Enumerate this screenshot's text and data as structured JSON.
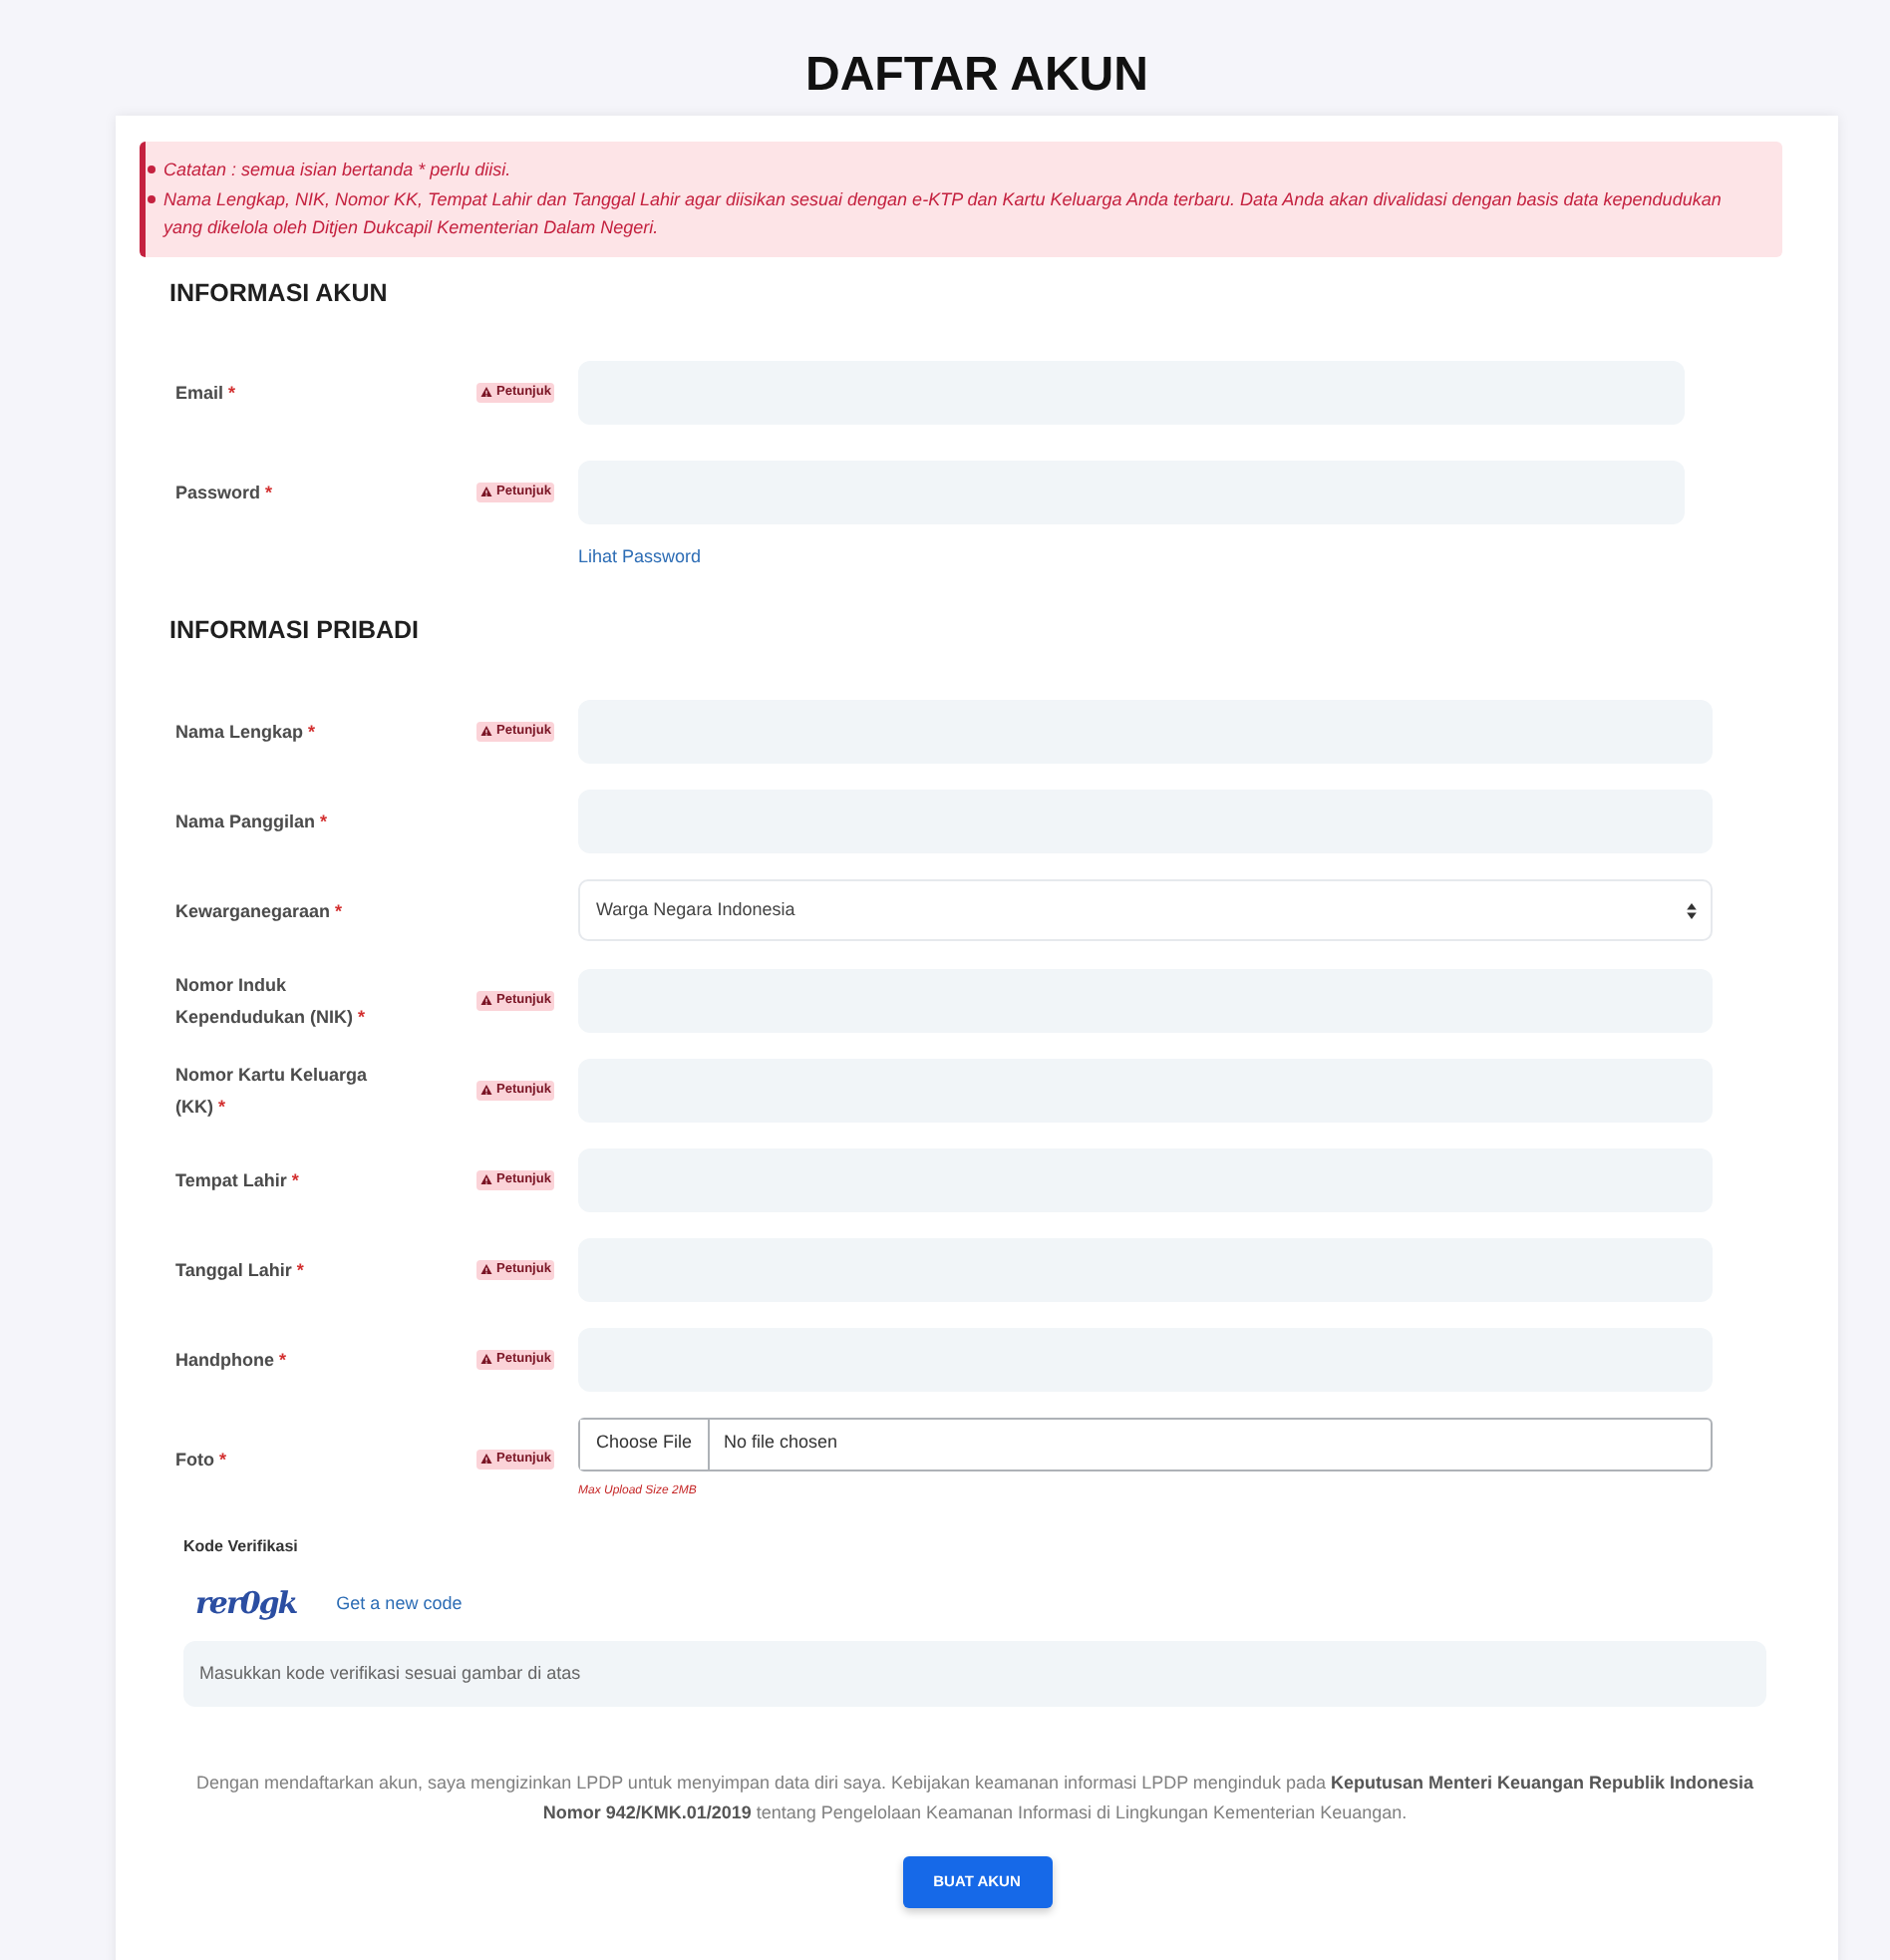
{
  "page": {
    "title": "DAFTAR AKUN"
  },
  "notice": {
    "items": [
      "Catatan : semua isian bertanda * perlu diisi.",
      "Nama Lengkap, NIK, Nomor KK, Tempat Lahir dan Tanggal Lahir agar diisikan sesuai dengan e-KTP dan Kartu Keluarga Anda terbaru. Data Anda akan divalidasi dengan basis data kependudukan yang dikelola oleh Ditjen Dukcapil Kementerian Dalam Negeri."
    ]
  },
  "sections": [
    {
      "title": "INFORMASI AKUN",
      "fields": [
        {
          "kind": "text",
          "label": "Email",
          "required_mark": "*",
          "hint": "Petunjuk"
        },
        {
          "kind": "text",
          "label": "Password",
          "required_mark": "*",
          "hint": "Petunjuk",
          "link": "Lihat Password"
        }
      ]
    },
    {
      "title": "INFORMASI PRIBADI",
      "fields": [
        {
          "kind": "text",
          "label": "Nama Lengkap",
          "required_mark": "*",
          "hint": "Petunjuk"
        },
        {
          "kind": "text",
          "label": "Nama Panggilan",
          "required_mark": "*"
        },
        {
          "kind": "select",
          "label": "Kewarganegaraan",
          "required_mark": "*",
          "value": "Warga Negara Indonesia"
        },
        {
          "kind": "text",
          "label": "Nomor Induk Kependudukan (NIK)",
          "required_mark": "*",
          "hint": "Petunjuk"
        },
        {
          "kind": "text",
          "label": "Nomor Kartu Keluarga (KK)",
          "required_mark": "*",
          "hint": "Petunjuk"
        },
        {
          "kind": "text",
          "label": "Tempat Lahir",
          "required_mark": "*",
          "hint": "Petunjuk"
        },
        {
          "kind": "text",
          "label": "Tanggal Lahir",
          "required_mark": "*",
          "hint": "Petunjuk"
        },
        {
          "kind": "text",
          "label": "Handphone",
          "required_mark": "*",
          "hint": "Petunjuk"
        },
        {
          "kind": "file",
          "label": "Foto",
          "required_mark": "*",
          "hint": "Petunjuk",
          "button": "Choose File",
          "status": "No file chosen",
          "note": "Max Upload Size 2MB"
        }
      ]
    }
  ],
  "verification": {
    "label": "Kode Verifikasi",
    "captcha": "rer0gk",
    "refresh_link": "Get a new code",
    "placeholder": "Masukkan kode verifikasi sesuai gambar di atas"
  },
  "consent": "Dengan mendaftarkan akun, saya mengizinkan LPDP untuk menyimpan data diri saya. Kebijakan keamanan informasi LPDP menginduk pada **Keputusan Menteri Keuangan Republik Indonesia Nomor 942/KMK.01/2019** tentang Pengelolaan Keamanan Informasi di Lingkungan Kementerian Keuangan.",
  "submit_button": "BUAT AKUN"
}
